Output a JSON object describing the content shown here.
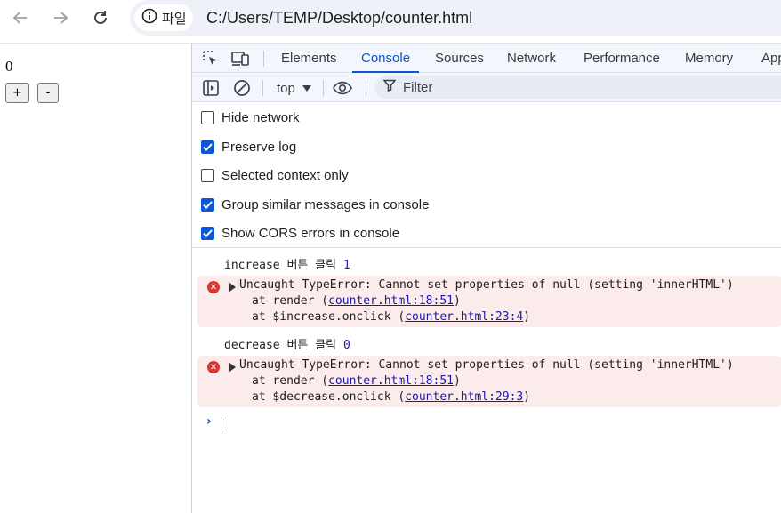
{
  "browser": {
    "site_chip_label": "파일",
    "url": "C:/Users/TEMP/Desktop/counter.html"
  },
  "page": {
    "counter_value": "0",
    "increase_label": "+",
    "decrease_label": "-"
  },
  "devtools": {
    "tabs": [
      {
        "label": "Elements",
        "active": false
      },
      {
        "label": "Console",
        "active": true
      },
      {
        "label": "Sources",
        "active": false
      },
      {
        "label": "Network",
        "active": false
      },
      {
        "label": "Performance",
        "active": false
      },
      {
        "label": "Memory",
        "active": false
      },
      {
        "label": "App",
        "active": false
      }
    ],
    "context": "top",
    "filter_placeholder": "Filter",
    "settings": [
      {
        "label": "Hide network",
        "checked": false
      },
      {
        "label": "Preserve log",
        "checked": true
      },
      {
        "label": "Selected context only",
        "checked": false
      },
      {
        "label": "Group similar messages in console",
        "checked": true
      },
      {
        "label": "Show CORS errors in console",
        "checked": true
      }
    ],
    "console": {
      "log1_text": "increase 버튼 클릭 ",
      "log1_value": "1",
      "error1": {
        "message": "Uncaught TypeError: Cannot set properties of null (setting 'innerHTML')",
        "frame1_prefix": "at render (",
        "frame1_link": "counter.html:18:51",
        "frame1_suffix": ")",
        "frame2_prefix": "at $increase.onclick (",
        "frame2_link": "counter.html:23:4",
        "frame2_suffix": ")"
      },
      "log2_text": "decrease 버튼 클릭 ",
      "log2_value": "0",
      "error2": {
        "message": "Uncaught TypeError: Cannot set properties of null (setting 'innerHTML')",
        "frame1_prefix": "at render (",
        "frame1_link": "counter.html:18:51",
        "frame1_suffix": ")",
        "frame2_prefix": "at $decrease.onclick (",
        "frame2_link": "counter.html:29:3",
        "frame2_suffix": ")"
      },
      "prompt_symbol": "›"
    }
  },
  "colors": {
    "accent": "#0b57d0",
    "error_bg": "#fcebeb",
    "error_icon": "#dc362e"
  }
}
